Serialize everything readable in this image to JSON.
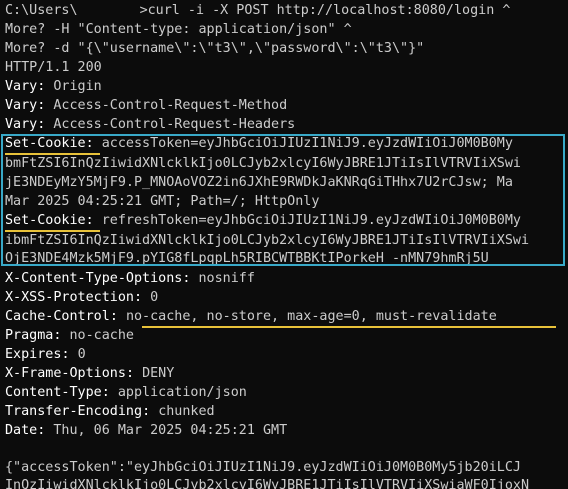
{
  "terminal": {
    "command": {
      "prompt_prefix": "C:\\Users\\",
      "prompt_suffix": ">curl -i -X POST http://localhost:8080/login ^",
      "more_1": "More? -H \"Content-type: application/json\" ^",
      "more_2": "More? -d \"{\\\"username\\\":\\\"t3\\\",\\\"password\\\":\\\"t3\\\"}\""
    },
    "status_line": "HTTP/1.1 200",
    "headers": [
      {
        "key": "Vary",
        "value": "Origin"
      },
      {
        "key": "Vary",
        "value": "Access-Control-Request-Method"
      },
      {
        "key": "Vary",
        "value": "Access-Control-Request-Headers"
      }
    ],
    "cookies": {
      "access_key": "Set-Cookie",
      "access_line_1": "accessToken=eyJhbGciOiJIUzI1NiJ9.eyJzdWIiOiJ0M0B0My",
      "access_line_2": "bmFtZSI6InQzIiwidXNlcklkIjo0LCJyb2xlcyI6WyJBRE1JTiIsIlVTRVIiXSwi",
      "access_line_3": "jE3NDEyMzY5MjF9.P_MNOAoVOZ2in6JXhE9RWDkJaKNRqGiTHhx7U2rCJsw; Ma",
      "access_line_4": "Mar 2025 04:25:21 GMT; Path=/; HttpOnly",
      "refresh_key": "Set-Cookie",
      "refresh_line_1": "refreshToken=eyJhbGciOiJIUzI1NiJ9.eyJzdWIiOiJ0M0B0My",
      "refresh_line_2": "ibmFtZSI6InQzIiwidXNlcklkIjo0LCJyb2xlcyI6WyJBRE1JTiIsIlVTRVIiXSwi",
      "refresh_line_3": "OjE3NDE4Mzk5MjF9.pYIG8fLpqpLh5RIBCWTBBKtIPorkeH_-nMN79hmRj5U"
    },
    "more_headers": [
      {
        "key": "X-Content-Type-Options",
        "value": "nosniff"
      },
      {
        "key": "X-XSS-Protection",
        "value": "0"
      },
      {
        "key": "Cache-Control",
        "value": "no-cache, no-store, max-age=0, must-revalidate"
      },
      {
        "key": "Pragma",
        "value": "no-cache"
      },
      {
        "key": "Expires",
        "value": "0"
      },
      {
        "key": "X-Frame-Options",
        "value": "DENY"
      },
      {
        "key": "Content-Type",
        "value": "application/json"
      },
      {
        "key": "Transfer-Encoding",
        "value": "chunked"
      },
      {
        "key": "Date",
        "value": "Thu, 06 Mar 2025 04:25:21 GMT"
      }
    ],
    "body_line_1": "{\"accessToken\":\"eyJhbGciOiJIUzI1NiJ9.eyJzdWIiOiJ0M0B0My5jb20iLCJ",
    "body_line_2": "InQzIiwidXNlcklkIjo0LCJyb2xlcyI6WyJBRE1JTiIsIlVTRVIiXSwiaWF0IjoxN"
  },
  "colors": {
    "background": "#0c0c0c",
    "text": "#cccccc",
    "key_text": "#ffffff",
    "highlight_border": "#39a9c8",
    "underline": "#e8c23a"
  }
}
